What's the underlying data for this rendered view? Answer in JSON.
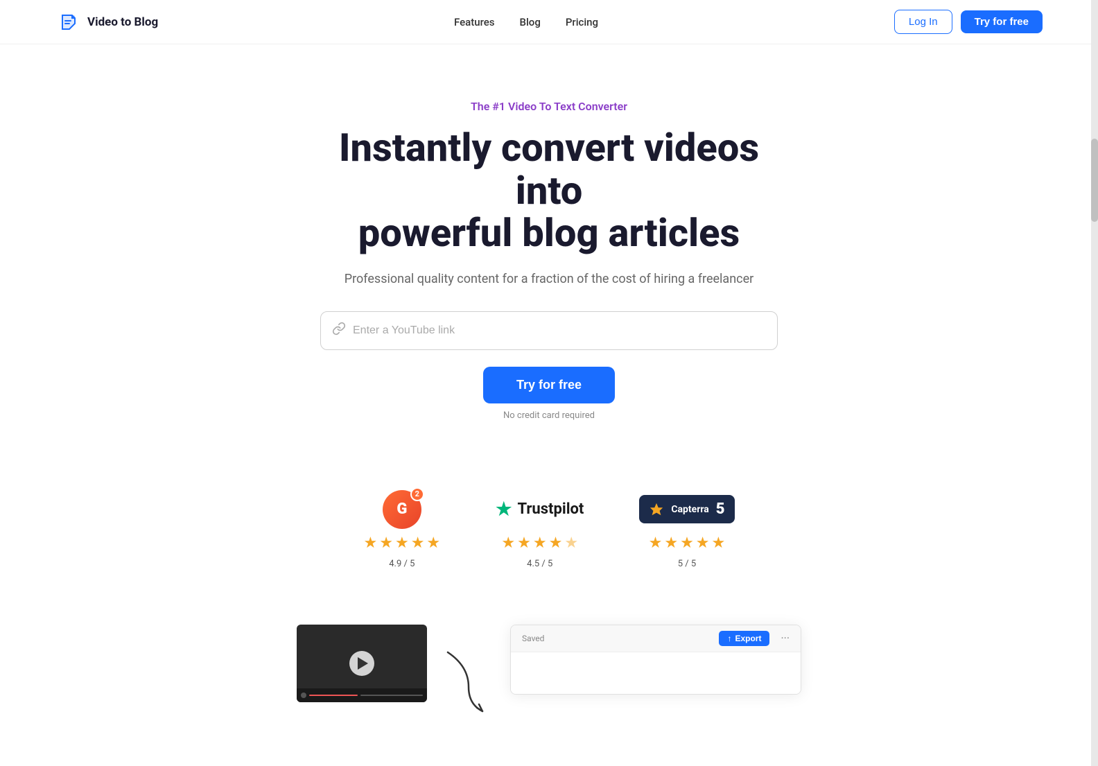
{
  "nav": {
    "logo_text": "Video to Blog",
    "links": [
      {
        "label": "Features",
        "id": "features"
      },
      {
        "label": "Blog",
        "id": "blog"
      },
      {
        "label": "Pricing",
        "id": "pricing"
      }
    ],
    "login_label": "Log In",
    "try_label": "Try for free"
  },
  "hero": {
    "tagline": "The #1 Video To Text Converter",
    "headline_line1": "Instantly convert videos into",
    "headline_line2": "powerful blog articles",
    "subheadline": "Professional quality content for a fraction of the cost of hiring a freelancer",
    "input_placeholder": "Enter a YouTube link",
    "cta_button": "Try for free",
    "no_credit": "No credit card required"
  },
  "ratings": [
    {
      "platform": "G2",
      "score": "4.9 / 5",
      "stars": 5,
      "badge_letter": "G",
      "badge_number": "2"
    },
    {
      "platform": "Trustpilot",
      "score": "4.5 / 5",
      "stars": 4.5
    },
    {
      "platform": "Capterra",
      "score": "5 / 5",
      "stars": 5,
      "badge_number": "5"
    }
  ],
  "demo": {
    "saved_label": "Saved",
    "export_label": "Export"
  }
}
